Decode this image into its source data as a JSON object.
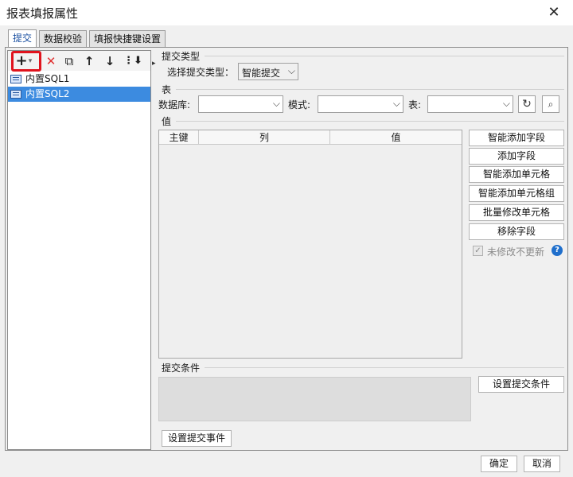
{
  "window": {
    "title": "报表填报属性",
    "close": "✕"
  },
  "tabs": [
    {
      "label": "提交"
    },
    {
      "label": "数据校验"
    },
    {
      "label": "填报快捷键设置"
    }
  ],
  "left_toolbar": {
    "add_icon": "+",
    "add_dropdown": "▾",
    "delete_icon": "✕",
    "copy_icon": "⧉",
    "up_icon": "↑",
    "down_icon": "↓",
    "more_icon": "⋮⬇"
  },
  "list_items": [
    {
      "label": "内置SQL1"
    },
    {
      "label": "内置SQL2"
    }
  ],
  "submit_type": {
    "section": "提交类型",
    "label": "选择提交类型：",
    "value": "智能提交"
  },
  "table_section": {
    "section": "表",
    "db_label": "数据库:",
    "schema_label": "模式:",
    "table_label": "表:"
  },
  "value_section": {
    "section": "值",
    "columns": [
      "主键",
      "列",
      "值"
    ]
  },
  "right_buttons": {
    "smart_add_field": "智能添加字段",
    "add_field": "添加字段",
    "smart_add_cell": "智能添加单元格",
    "smart_add_cell_group": "智能添加单元格组",
    "batch_modify_cell": "批量修改单元格",
    "remove_field": "移除字段"
  },
  "checkbox": {
    "label": "未修改不更新",
    "help": "?"
  },
  "condition": {
    "section": "提交条件",
    "button": "设置提交条件"
  },
  "event_button": "设置提交事件",
  "footer": {
    "ok": "确定",
    "cancel": "取消"
  },
  "colors": {
    "selection": "#3c8be0",
    "highlight": "#e0141e",
    "delete": "#e03030",
    "help": "#1f6fcc"
  }
}
